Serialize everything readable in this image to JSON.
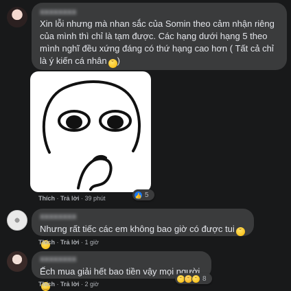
{
  "comments": [
    {
      "author": "xxxxxxxx",
      "text": "Xin lỗi nhưng mà nhan sắc của Somin theo cảm nhận riêng của mình thì chỉ là tạm được. Các hạng dưới hạng 5 theo mình nghĩ đều xứng đáng có thứ hạng cao hơn ( Tất cả chỉ là ý kiến cá nhân",
      "like": "Thích",
      "reply": "Trả lời",
      "time": "39 phút",
      "reaction_count": "5",
      "reaction_icons": [
        "like-icon"
      ]
    },
    {
      "author": "xxxxxxxx",
      "text": "Nhưng rất tiếc các em không bao giờ có được tui",
      "like": "Thích",
      "reply": "Trả lời",
      "time": "1 giờ"
    },
    {
      "author": "xxxxxxxx",
      "text": "Ếch mua giải hết bao tiền vậy mọi người",
      "like": "Thích",
      "reply": "Trả lời",
      "time": "2 giờ",
      "reaction_count": "8",
      "reaction_icons": [
        "haha-icon",
        "sad-icon",
        "haha-icon"
      ]
    }
  ],
  "separator": "·"
}
